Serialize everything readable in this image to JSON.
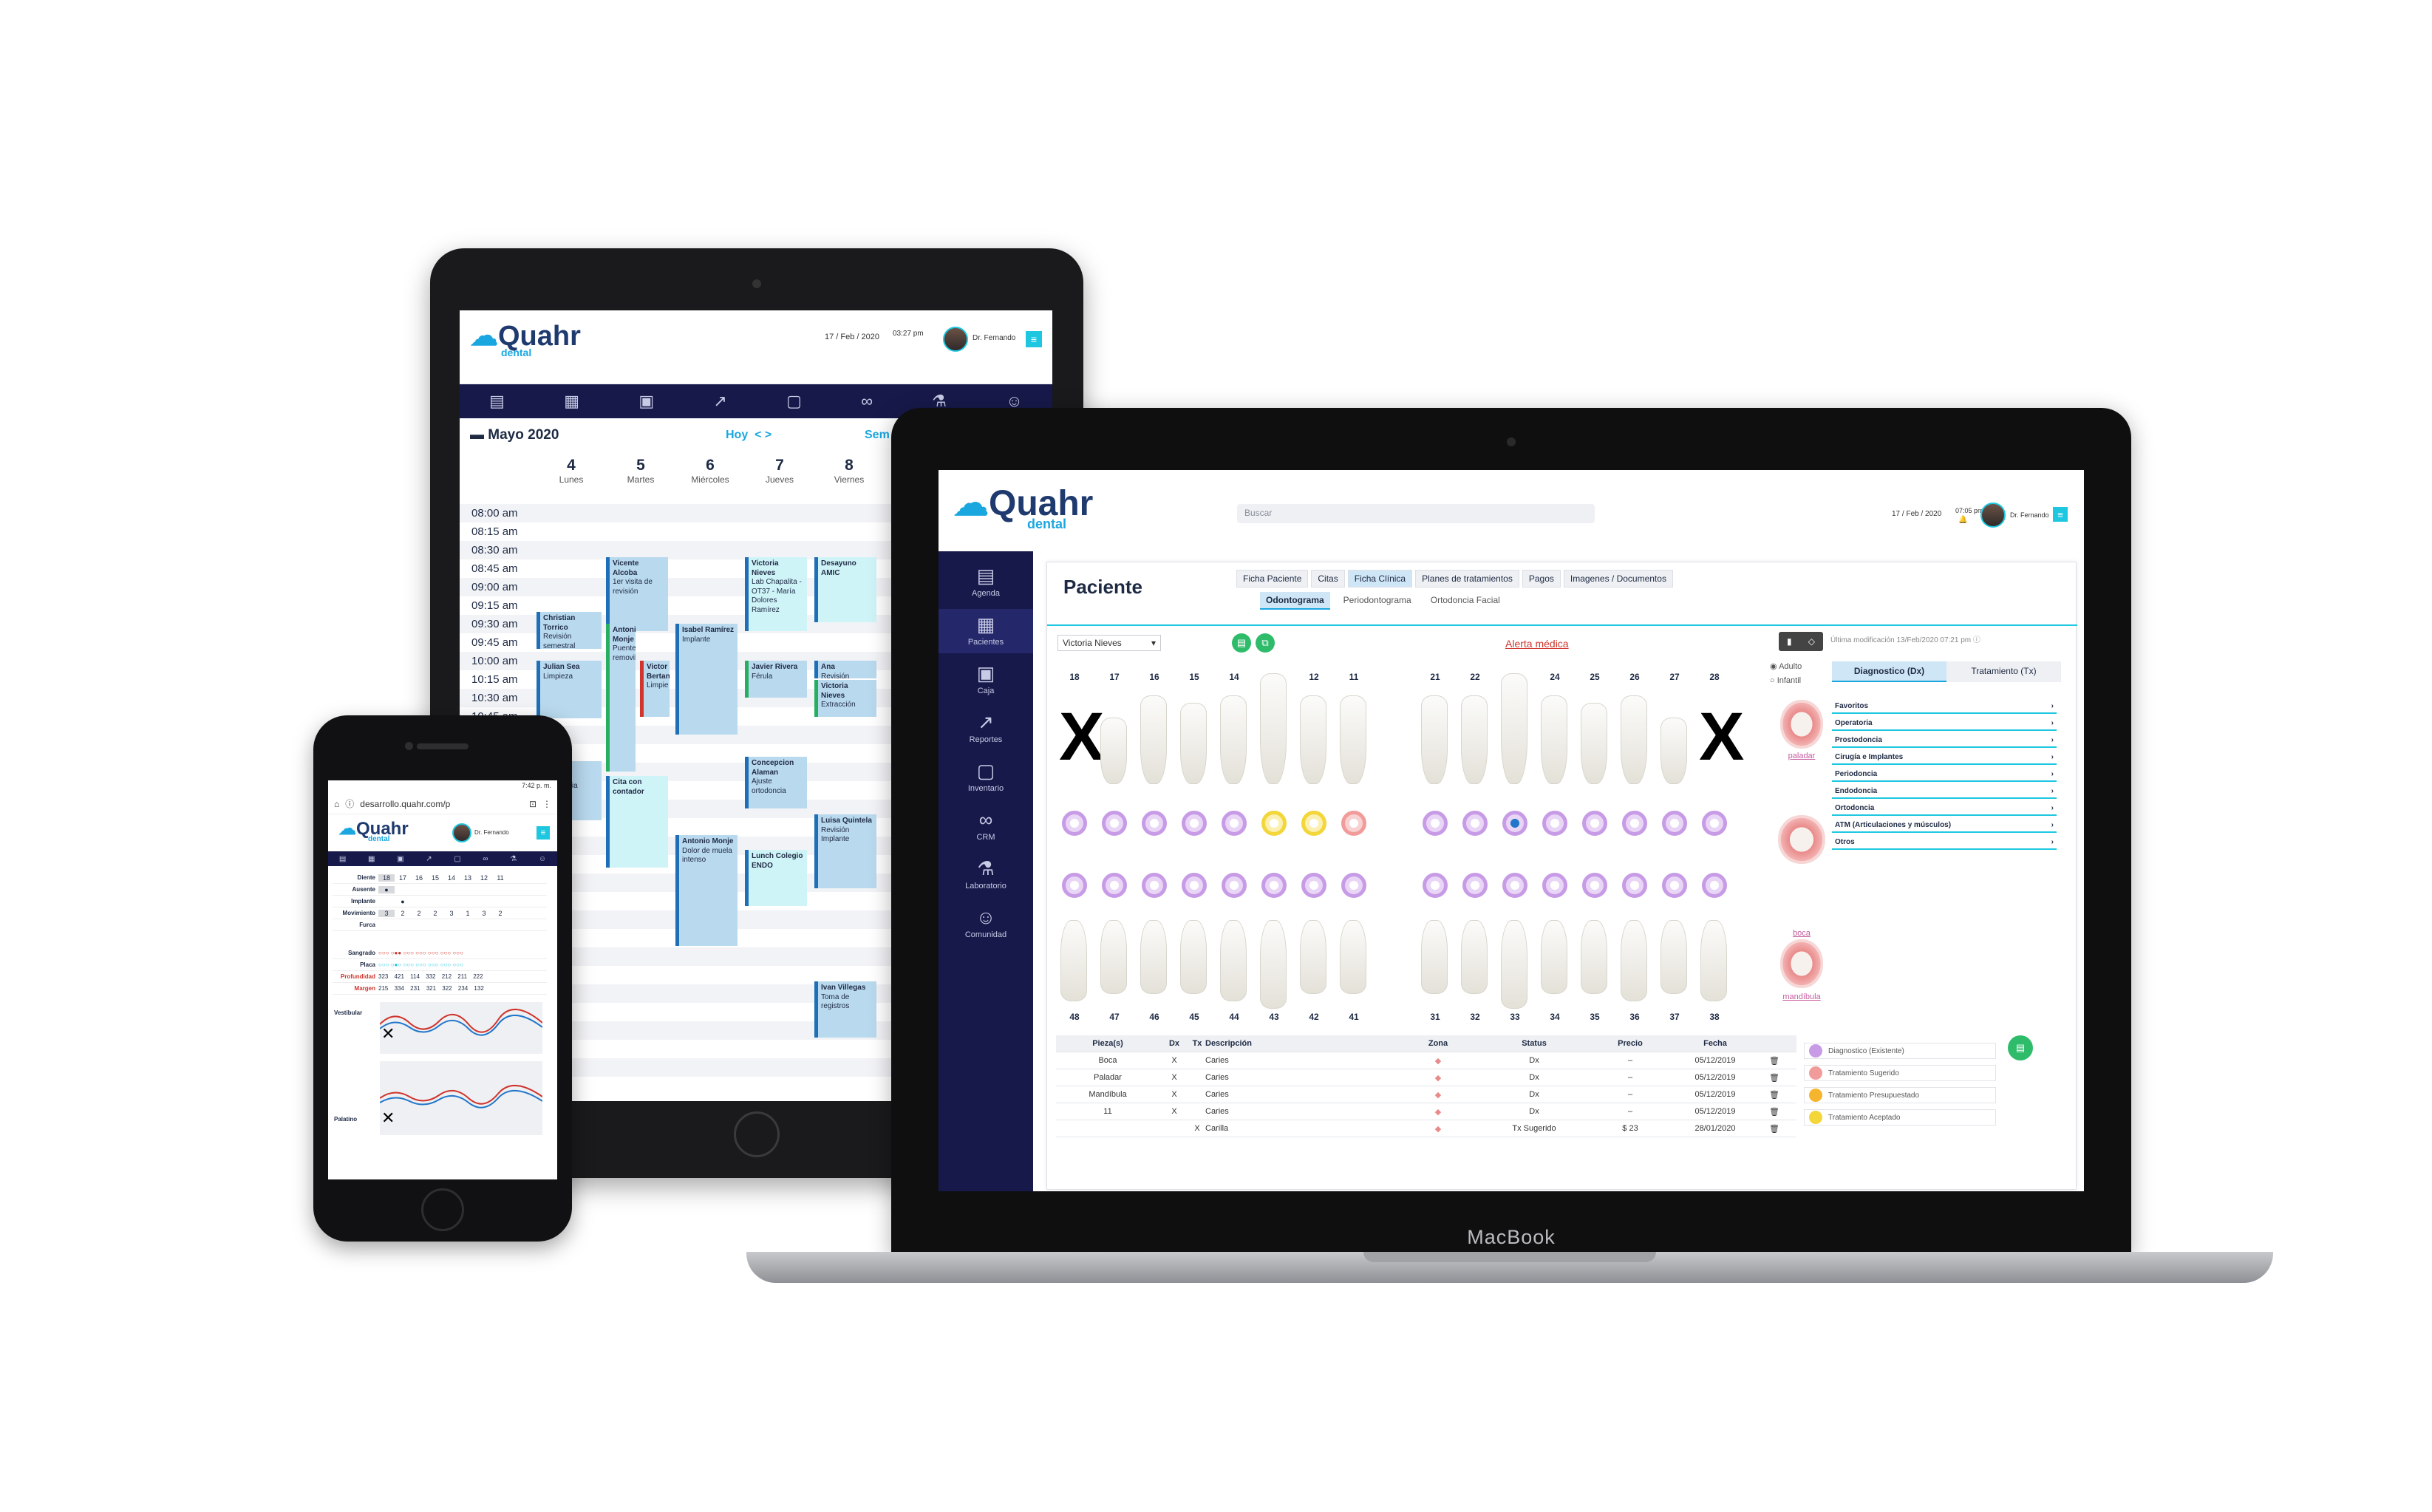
{
  "tablet": {
    "logo_main": "Quahr",
    "logo_sub": "dental",
    "date": "17 / Feb / 2020",
    "time": "03:27 pm",
    "user": "Dr. Fernando",
    "month": "Mayo 2020",
    "nav_hoy": "Hoy",
    "nav_arrows": "< >",
    "nav_sem": "Sem",
    "days": [
      {
        "num": "4",
        "name": "Lunes"
      },
      {
        "num": "5",
        "name": "Martes"
      },
      {
        "num": "6",
        "name": "Miércoles"
      },
      {
        "num": "7",
        "name": "Jueves"
      },
      {
        "num": "8",
        "name": "Viernes"
      }
    ],
    "times": [
      "08:00 am",
      "08:15 am",
      "08:30 am",
      "08:45 am",
      "09:00 am",
      "09:15 am",
      "09:30 am",
      "09:45 am",
      "10:00 am",
      "10:15 am",
      "10:30 am",
      "10:45 am"
    ],
    "events": [
      {
        "name": "Vicente Alcoba",
        "note": "1er visita de revisión"
      },
      {
        "name": "Victoria Nieves",
        "note": "Lab Chapalita - OT37 - María Dolores Ramírez"
      },
      {
        "name": "Desayuno AMIC",
        "note": ""
      },
      {
        "name": "Christian Torrico",
        "note": "Revisión semestral"
      },
      {
        "name": "Antonia Monje",
        "note": "Puente removible"
      },
      {
        "name": "Isabel Ramírez",
        "note": "Implante"
      },
      {
        "name": "Julian Sea",
        "note": "Limpieza"
      },
      {
        "name": "Victor Bertang",
        "note": "Limpie"
      },
      {
        "name": "Javier Rivera",
        "note": "Férula"
      },
      {
        "name": "Ana",
        "note": "Revisión"
      },
      {
        "name": "Victoria Nieves",
        "note": "Extracción"
      },
      {
        "name": "Concepcion Alaman",
        "note": "Ajuste ortodoncia"
      },
      {
        "name": "Cita con contador",
        "note": ""
      },
      {
        "name": "Luisa Quintela",
        "note": "Revisión Implante"
      },
      {
        "name": "Antonio Monje",
        "note": "Dolor de muela intenso"
      },
      {
        "name": "Lunch Colegio ENDO",
        "note": ""
      },
      {
        "name": "Ivan Villegas",
        "note": "Toma de registros"
      },
      {
        "name": "Torrico",
        "note": "Revisión ortodoncia"
      }
    ]
  },
  "phone": {
    "status": "7:42 p. m.",
    "url": "desarrollo.quahr.com/p",
    "logo_main": "Quahr",
    "logo_sub": "dental",
    "user": "Dr. Fernando",
    "teeth": [
      "18",
      "17",
      "16",
      "15",
      "14",
      "13",
      "12",
      "11"
    ],
    "rows": [
      {
        "label": "Diente",
        "vals": [
          "18",
          "17",
          "16",
          "15",
          "14",
          "13",
          "12",
          "11"
        ]
      },
      {
        "label": "Ausente",
        "vals": [
          "●",
          "",
          "",
          "",
          "",
          "",
          "",
          ""
        ]
      },
      {
        "label": "Implante",
        "vals": [
          "",
          "●",
          "",
          "",
          "",
          "",
          "",
          ""
        ]
      },
      {
        "label": "Movimiento",
        "vals": [
          "3",
          "2",
          "2",
          "2",
          "3",
          "1",
          "3",
          "2"
        ]
      },
      {
        "label": "Furca",
        "vals": [
          "",
          "",
          "",
          "",
          "",
          "",
          "",
          ""
        ]
      }
    ],
    "perio_labels": [
      "Sangrado",
      "Placa",
      "Profundidad",
      "Margen"
    ],
    "depth": [
      "323",
      "421",
      "114",
      "332",
      "212",
      "211",
      "222"
    ],
    "margin": [
      "215",
      "334",
      "231",
      "321",
      "322",
      "234",
      "132"
    ],
    "vestibular": "Vestibular",
    "palatino": "Palatino"
  },
  "laptop": {
    "logo_main": "Quahr",
    "logo_sub": "dental",
    "search_placeholder": "Buscar",
    "date": "17 / Feb / 2020",
    "time": "07:05 pm",
    "user": "Dr. Fernando",
    "sidebar": [
      "Agenda",
      "Pacientes",
      "Caja",
      "Reportes",
      "Inventario",
      "CRM",
      "Laboratorio",
      "Comunidad"
    ],
    "title": "Paciente",
    "tabs": [
      "Ficha Paciente",
      "Citas",
      "Ficha Clínica",
      "Planes de tratamientos",
      "Pagos",
      "Imagenes / Documentos"
    ],
    "subtabs": [
      "Odontograma",
      "Periodontograma",
      "Ortodoncia Facial"
    ],
    "patient": "Victoria Nieves",
    "alert": "Alerta médica",
    "last_mod": "Última modificación 13/Feb/2020 07:21 pm",
    "radio_adulto": "Adulto",
    "radio_infantil": "Infantil",
    "upper_teeth": [
      "18",
      "17",
      "16",
      "15",
      "14",
      "13",
      "12",
      "11",
      "21",
      "22",
      "23",
      "24",
      "25",
      "26",
      "27",
      "28"
    ],
    "lower_teeth": [
      "48",
      "47",
      "46",
      "45",
      "44",
      "43",
      "42",
      "41",
      "31",
      "32",
      "33",
      "34",
      "35",
      "36",
      "37",
      "38"
    ],
    "mouth_labels": [
      "paladar",
      "boca",
      "mandíbula"
    ],
    "dx_tabs": [
      "Diagnostico (Dx)",
      "Tratamiento (Tx)"
    ],
    "categories": [
      "Favoritos",
      "Operatoria",
      "Prostodoncia",
      "Cirugía e Implantes",
      "Periodoncia",
      "Endodoncia",
      "Ortodoncia",
      "ATM (Articulaciones y músculos)",
      "Otros"
    ],
    "table_headers": [
      "Pieza(s)",
      "Dx",
      "Tx",
      "Descripción",
      "Zona",
      "Status",
      "Precio",
      "Fecha"
    ],
    "table_rows": [
      {
        "pieza": "Boca",
        "dx": "X",
        "tx": "",
        "desc": "Caries",
        "status": "Dx",
        "precio": "–",
        "fecha": "05/12/2019"
      },
      {
        "pieza": "Paladar",
        "dx": "X",
        "tx": "",
        "desc": "Caries",
        "status": "Dx",
        "precio": "–",
        "fecha": "05/12/2019"
      },
      {
        "pieza": "Mandíbula",
        "dx": "X",
        "tx": "",
        "desc": "Caries",
        "status": "Dx",
        "precio": "–",
        "fecha": "05/12/2019"
      },
      {
        "pieza": "11",
        "dx": "X",
        "tx": "",
        "desc": "Caries",
        "status": "Dx",
        "precio": "–",
        "fecha": "05/12/2019"
      },
      {
        "pieza": "",
        "dx": "",
        "tx": "X",
        "desc": "Carilla",
        "status": "Tx Sugerido",
        "precio": "$ 23",
        "fecha": "28/01/2020"
      }
    ],
    "legend": [
      {
        "label": "Diagnostico (Existente)",
        "color": "#c79be6"
      },
      {
        "label": "Tratamiento Sugerido",
        "color": "#f29b9b"
      },
      {
        "label": "Tratamiento Presupuestado",
        "color": "#f5b52e"
      },
      {
        "label": "Tratamiento Aceptado",
        "color": "#f2d63a"
      }
    ],
    "brand": "MacBook"
  },
  "colors": {
    "navy": "#17194a",
    "cyan": "#1ec7e0",
    "blue": "#1aa7e0",
    "alert": "#d0342c"
  }
}
